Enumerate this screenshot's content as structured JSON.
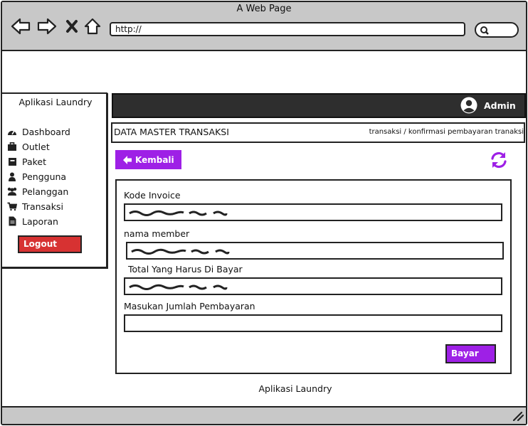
{
  "browser": {
    "window_title": "A Web Page",
    "url": "http://"
  },
  "sidebar": {
    "title": "Aplikasi Laundry",
    "items": [
      {
        "label": "Dashboard",
        "icon": "dashboard-icon"
      },
      {
        "label": "Outlet",
        "icon": "briefcase-icon"
      },
      {
        "label": "Paket",
        "icon": "package-icon"
      },
      {
        "label": "Pengguna",
        "icon": "user-icon"
      },
      {
        "label": "Pelanggan",
        "icon": "users-icon"
      },
      {
        "label": "Transaksi",
        "icon": "cart-icon"
      },
      {
        "label": "Laporan",
        "icon": "document-icon"
      }
    ],
    "logout_label": "Logout"
  },
  "topbar": {
    "user": "Admin"
  },
  "header": {
    "title": "DATA MASTER TRANSAKSI",
    "breadcrumb": "transaksi / konfirmasi pembayaran tranaksi"
  },
  "actions": {
    "back_label": "Kembali"
  },
  "form": {
    "fields": [
      {
        "label": "Kode Invoice",
        "filled": true
      },
      {
        "label": "nama member",
        "filled": true
      },
      {
        "label": "Total Yang Harus Di Bayar",
        "filled": true
      },
      {
        "label": "Masukan Jumlah Pembayaran",
        "filled": false
      }
    ],
    "submit_label": "Bayar"
  },
  "footer": {
    "text": "Aplikasi Laundry"
  },
  "colors": {
    "accent": "#9e20e6",
    "logout": "#d73232",
    "topbar": "#2e2e2e",
    "chrome": "#c8c8c8"
  }
}
